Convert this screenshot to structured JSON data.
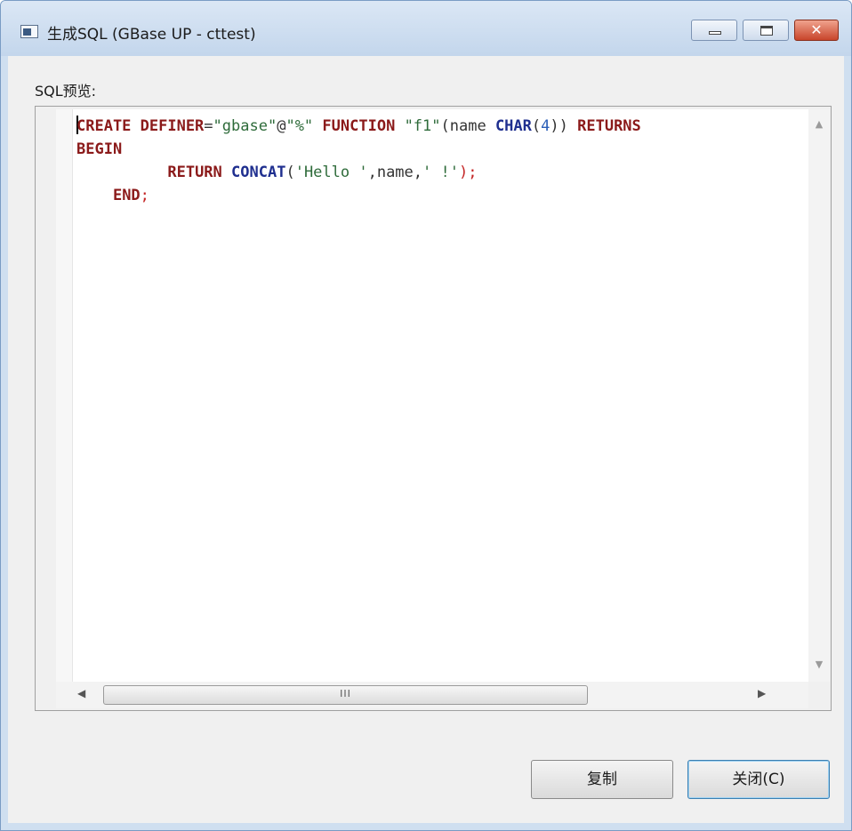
{
  "window": {
    "title": "生成SQL (GBase UP - cttest)",
    "controls": {
      "minimize": "minimize",
      "maximize": "maximize",
      "close": "✕"
    }
  },
  "preview_label": "SQL预览:",
  "sql": {
    "line1": {
      "kw1": "CREATE DEFINER",
      "eq": "=",
      "s1": "\"gbase\"",
      "at": "@",
      "s2": "\"%\"",
      "kw2": "FUNCTION",
      "s3": "\"f1\"",
      "p1": "(name ",
      "kw3": "CHAR",
      "p2": "(",
      "num": "4",
      "p3": "))",
      "kw4": "RETURNS"
    },
    "line2": {
      "kw": "BEGIN"
    },
    "line3": {
      "kw": "RETURN",
      "fn": "CONCAT",
      "p1": "(",
      "s1": "'Hello '",
      "p2": ",name,",
      "s2": "' !'",
      "p3": ");"
    },
    "line4": {
      "kw": "END",
      "semi": ";"
    }
  },
  "scrollbars": {
    "up": "▲",
    "down": "▼",
    "left": "◀",
    "right": "▶",
    "grip": "III"
  },
  "buttons": {
    "copy": "复制",
    "close": "关闭(C)"
  },
  "colors": {
    "keyword": "#8b1a1a",
    "function": "#1f2f8f",
    "string": "#2e6b3a",
    "number": "#2b5fb8"
  }
}
